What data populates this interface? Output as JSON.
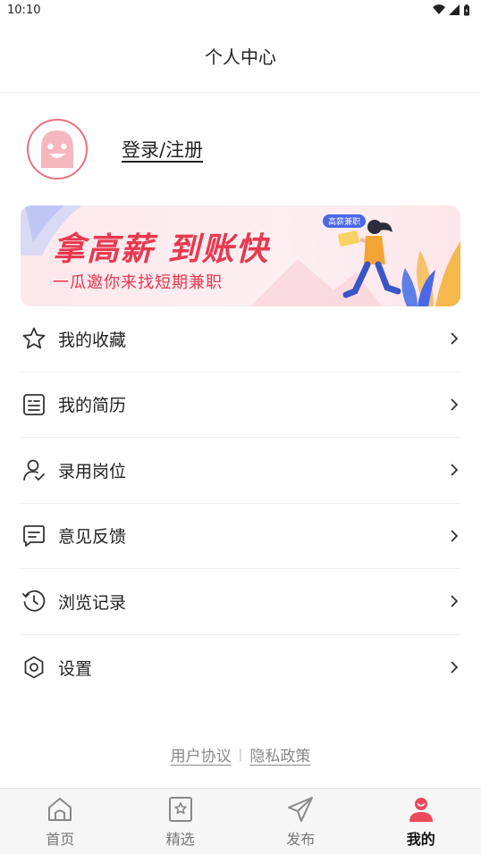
{
  "status_bar": {
    "time": "10:10"
  },
  "header": {
    "title": "个人中心"
  },
  "profile": {
    "login_label": "登录/注册"
  },
  "banner": {
    "headline": "拿高薪 到账快",
    "subline": "一瓜邀你来找短期兼职",
    "tag": "高薪兼职"
  },
  "menu": {
    "items": [
      {
        "label": "我的收藏",
        "icon": "star-icon"
      },
      {
        "label": "我的简历",
        "icon": "resume-icon"
      },
      {
        "label": "录用岗位",
        "icon": "user-check-icon"
      },
      {
        "label": "意见反馈",
        "icon": "feedback-icon"
      },
      {
        "label": "浏览记录",
        "icon": "history-icon"
      },
      {
        "label": "设置",
        "icon": "gear-icon"
      }
    ]
  },
  "footer": {
    "user_agreement": "用户协议",
    "privacy_policy": "隐私政策"
  },
  "tabbar": {
    "tabs": [
      {
        "label": "首页",
        "icon": "home-icon"
      },
      {
        "label": "精选",
        "icon": "featured-icon"
      },
      {
        "label": "发布",
        "icon": "send-icon"
      },
      {
        "label": "我的",
        "icon": "profile-icon",
        "active": true
      }
    ]
  },
  "colors": {
    "accent": "#e8394f",
    "avatar_border": "#e8707d",
    "tag_blue": "#4a68e8"
  }
}
